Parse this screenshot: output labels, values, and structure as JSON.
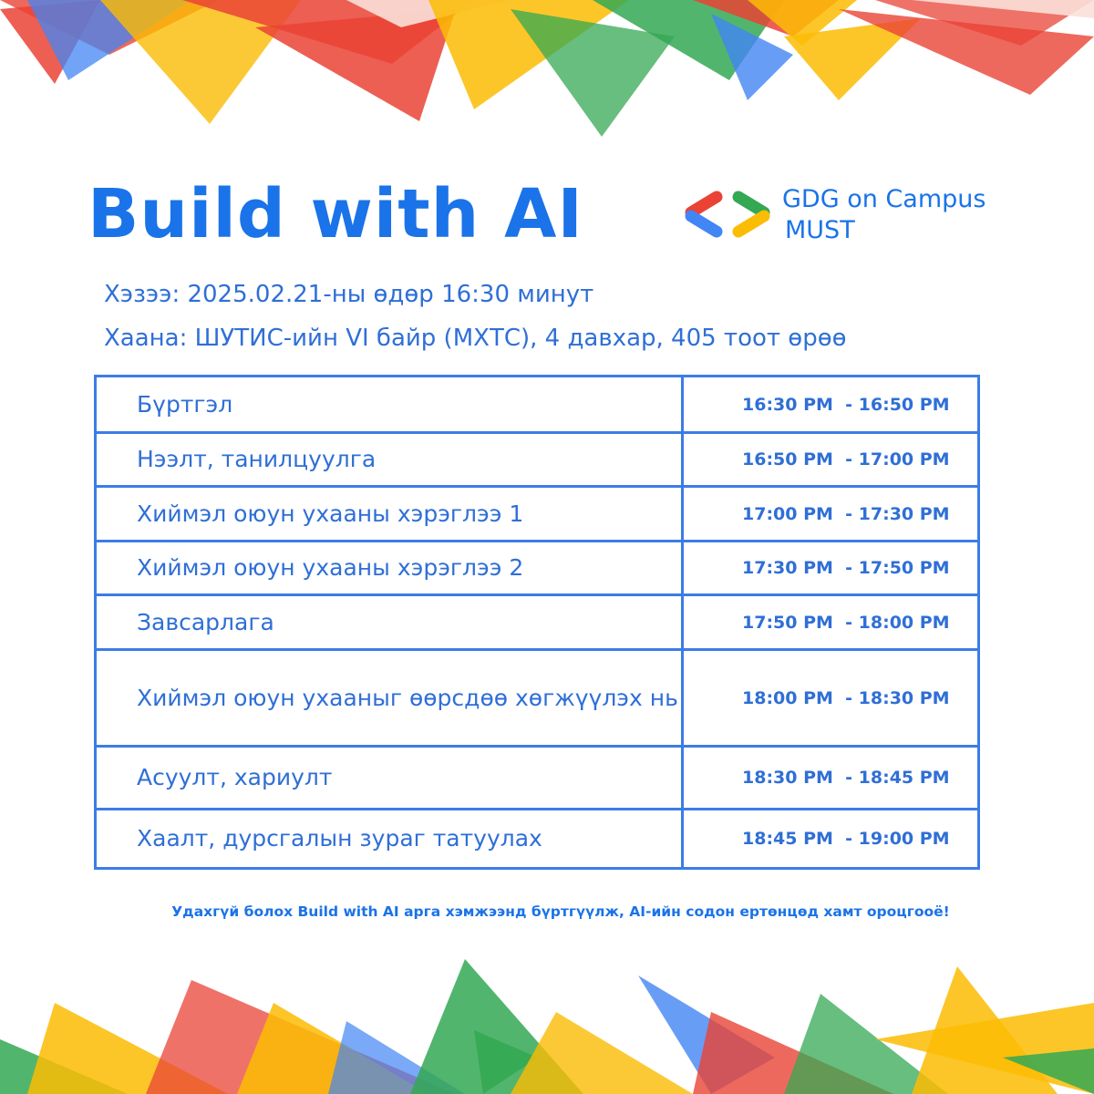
{
  "colors": {
    "brand_blue": "#1a73e8",
    "text_blue": "#2f6fd6",
    "table_border": "#3c7ce6",
    "google_red": "#ea4335",
    "google_yellow": "#fbbc04",
    "google_green": "#34a853",
    "google_blue": "#4285f4"
  },
  "header": {
    "title": "Build with AI"
  },
  "logo": {
    "icon": "gdg-brackets-icon",
    "line1": "GDG on Campus",
    "line2": "MUST"
  },
  "event": {
    "when": "Хэзээ: 2025.02.21-ны өдөр  16:30 минут",
    "where": "Хаана: ШУТИС-ийн VI байр (МХТС), 4 давхар, 405 тоот өрөө"
  },
  "schedule": [
    {
      "activity": "Бүртгэл",
      "time": "16:30 PM  - 16:50 PM"
    },
    {
      "activity": "Нээлт, танилцуулга",
      "time": "16:50 PM  - 17:00 PM"
    },
    {
      "activity": "Хиймэл оюун ухааны хэрэглээ 1",
      "time": "17:00 PM  - 17:30 PM"
    },
    {
      "activity": "Хиймэл оюун ухааны хэрэглээ 2",
      "time": "17:30 PM  - 17:50 PM"
    },
    {
      "activity": "Завсарлага",
      "time": "17:50 PM  - 18:00 PM"
    },
    {
      "activity": "Хиймэл оюун ухааныг өөрсдөө хөгжүүлэх нь",
      "time": "18:00 PM  - 18:30 PM"
    },
    {
      "activity": "Асуулт, хариулт",
      "time": "18:30 PM  - 18:45 PM"
    },
    {
      "activity": "Хаалт, дурсгалын зураг татуулах",
      "time": "18:45 PM  - 19:00 PM"
    }
  ],
  "footer": {
    "text": "Удахгүй болох Build with AI арга хэмжээнд бүртгүүлж, AI-ийн содон ертөнцөд хамт ороцгооё!"
  }
}
